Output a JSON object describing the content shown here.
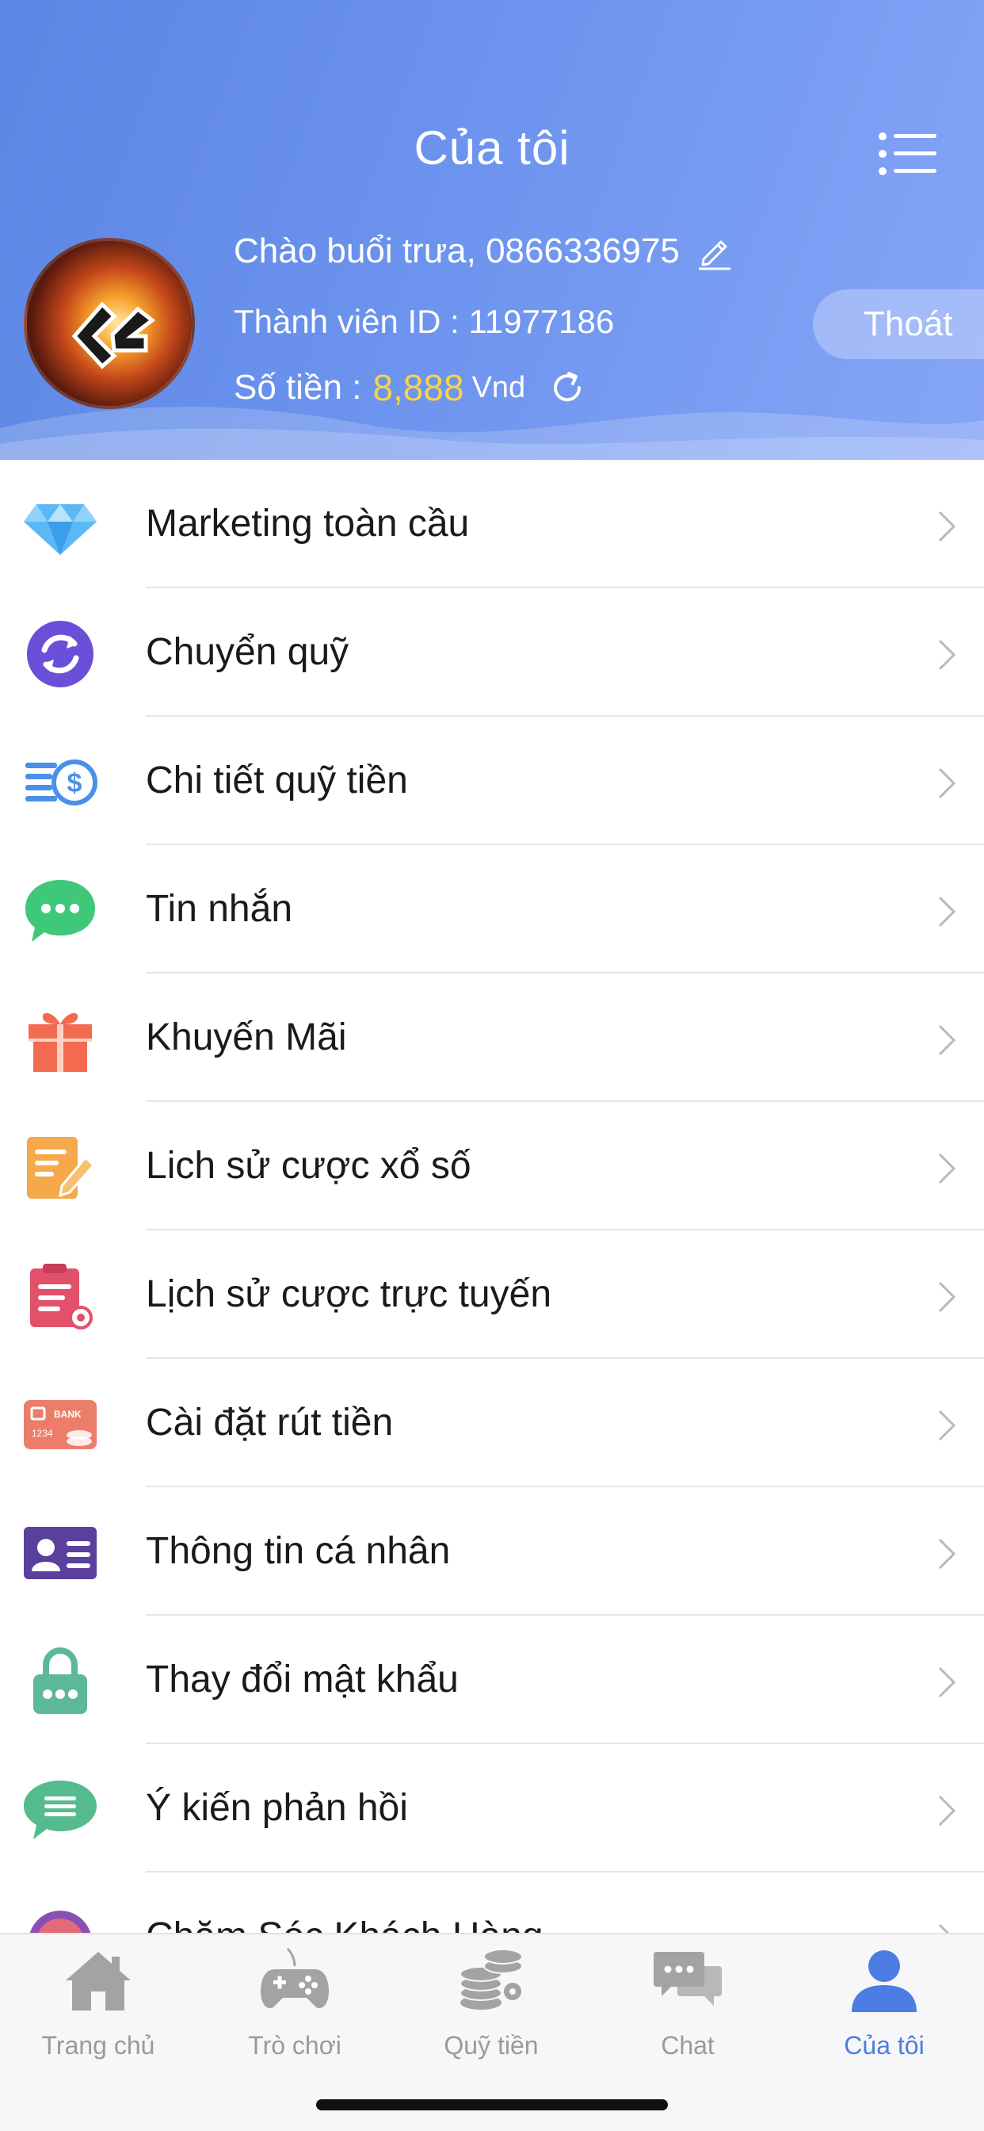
{
  "header": {
    "title": "Của tôi",
    "greeting": "Chào buổi trưa, 0866336975",
    "member_id": "Thành viên ID : 11977186",
    "balance_label": "Số tiền :",
    "balance_value": "8,888",
    "balance_unit": "Vnd",
    "logout_label": "Thoát",
    "balance_color": "#f8d24a"
  },
  "menu": {
    "items": [
      {
        "label": "Marketing toàn cầu",
        "icon": "diamond-icon"
      },
      {
        "label": "Chuyển quỹ",
        "icon": "transfer-icon"
      },
      {
        "label": "Chi tiết quỹ tiền",
        "icon": "fund-details-icon"
      },
      {
        "label": "Tin nhắn",
        "icon": "message-icon"
      },
      {
        "label": "Khuyến Mãi",
        "icon": "gift-icon"
      },
      {
        "label": "Lich sử cược xổ số",
        "icon": "lottery-history-icon"
      },
      {
        "label": "Lịch sử cược trực tuyến",
        "icon": "online-bet-history-icon"
      },
      {
        "label": "Cài đặt rút tiền",
        "icon": "bank-card-icon"
      },
      {
        "label": "Thông tin cá nhân",
        "icon": "id-card-icon"
      },
      {
        "label": "Thay đổi mật khẩu",
        "icon": "lock-icon"
      },
      {
        "label": "Ý kiến phản hồi",
        "icon": "feedback-icon"
      },
      {
        "label": "Chăm Sóc Khách Hàng",
        "icon": "customer-care-icon"
      }
    ]
  },
  "tabbar": {
    "tabs": [
      {
        "label": "Trang chủ",
        "icon": "home-icon"
      },
      {
        "label": "Trò chơi",
        "icon": "gamepad-icon"
      },
      {
        "label": "Quỹ tiền",
        "icon": "coins-icon"
      },
      {
        "label": "Chat",
        "icon": "chat-icon"
      },
      {
        "label": "Của tôi",
        "icon": "user-icon"
      }
    ],
    "active_color": "#4b7de3",
    "inactive_color": "#9a9a9a"
  }
}
